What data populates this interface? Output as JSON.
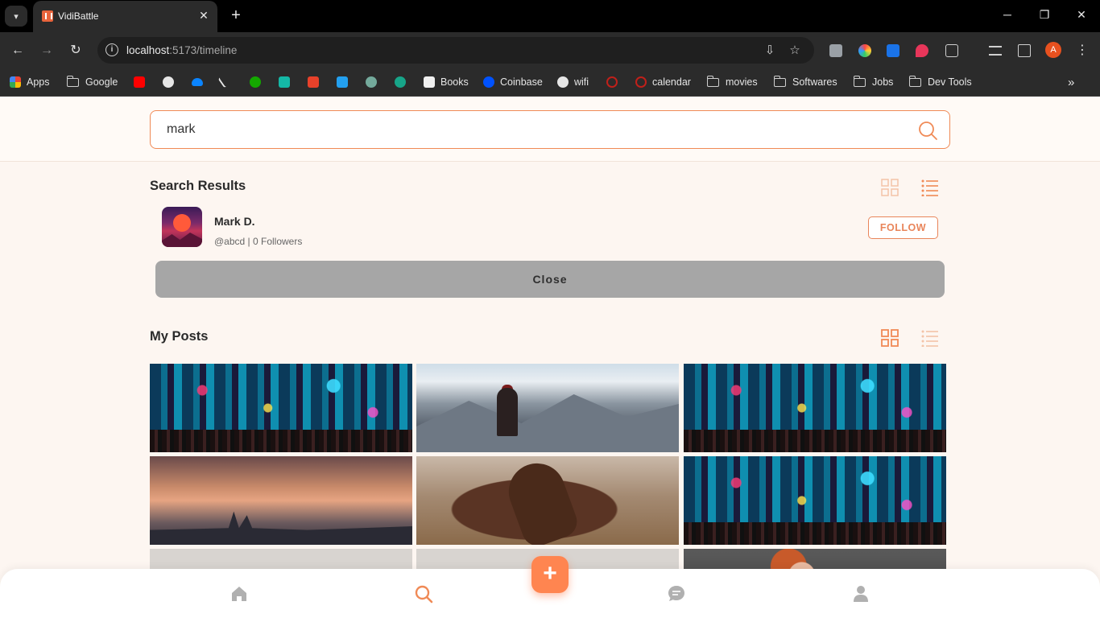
{
  "browser": {
    "tab_title": "VidiBattle",
    "url_host": "localhost",
    "url_path": ":5173/timeline",
    "profile_initial": "A",
    "bookmarks": [
      {
        "label": "Apps"
      },
      {
        "label": "Google"
      },
      {
        "label": "Books"
      },
      {
        "label": "Coinbase"
      },
      {
        "label": "wifi"
      },
      {
        "label": "calendar"
      },
      {
        "label": "movies"
      },
      {
        "label": "Softwares"
      },
      {
        "label": "Jobs"
      },
      {
        "label": "Dev Tools"
      }
    ]
  },
  "search": {
    "value": "mark",
    "placeholder": ""
  },
  "results": {
    "title": "Search Results",
    "items": [
      {
        "name": "Mark D.",
        "meta": "@abcd | 0 Followers",
        "follow_label": "FOLLOW"
      }
    ],
    "close_label": "Close"
  },
  "posts": {
    "title": "My Posts"
  },
  "colors": {
    "accent": "#ff8550",
    "search_border": "#f08a56",
    "close_button": "#a6a6a6"
  }
}
